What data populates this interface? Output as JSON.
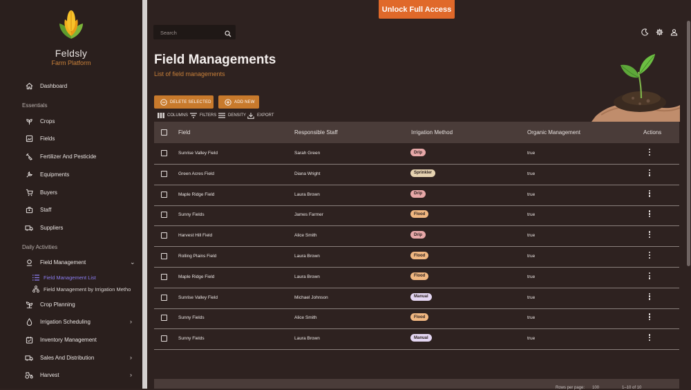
{
  "brand": {
    "name": "Feldsly",
    "subtitle": "Farm Platform"
  },
  "banner": {
    "label": "Unlock Full Access"
  },
  "search": {
    "placeholder": "Search"
  },
  "sidebar": {
    "top": {
      "label": "Dashboard",
      "icon": "home-icon"
    },
    "sections": [
      {
        "title": "Essentials",
        "items": [
          {
            "label": "Crops",
            "icon": "crops-icon"
          },
          {
            "label": "Fields",
            "icon": "fields-icon"
          },
          {
            "label": "Fertilizer And Pesticide",
            "icon": "spray-icon"
          },
          {
            "label": "Equipments",
            "icon": "tools-icon"
          },
          {
            "label": "Buyers",
            "icon": "cart-icon"
          },
          {
            "label": "Staff",
            "icon": "staff-icon"
          },
          {
            "label": "Suppliers",
            "icon": "truck-icon"
          }
        ]
      },
      {
        "title": "Daily Activities",
        "items": [
          {
            "label": "Field Management",
            "icon": "location-icon",
            "expanded": true
          },
          {
            "label": "Crop Planning",
            "icon": "sprout-icon"
          },
          {
            "label": "Irrigation Scheduling",
            "icon": "water-drop-icon"
          },
          {
            "label": "Inventory Management",
            "icon": "inventory-icon"
          },
          {
            "label": "Sales And Distribution",
            "icon": "truck-icon"
          },
          {
            "label": "Harvest",
            "icon": "tractor-icon"
          }
        ]
      }
    ],
    "sub_items": [
      {
        "label": "Field Management List",
        "icon": "list-icon",
        "active": true
      },
      {
        "label": "Field Management by Irrigation Metho",
        "icon": "hierarchy-icon",
        "active": false
      }
    ]
  },
  "page": {
    "title": "Field Managements",
    "subtitle": "List of field managements"
  },
  "actions": {
    "delete_label": "DELETE SELECTED",
    "add_label": "ADD NEW"
  },
  "toolbar": {
    "columns_label": "COLUMNS",
    "filters_label": "FILTERS",
    "density_label": "DENSITY",
    "export_label": "EXPORT"
  },
  "table": {
    "columns": [
      "Field",
      "Responsible Staff",
      "Irrigation Method",
      "Organic Management",
      "Actions"
    ],
    "rows": [
      {
        "field": "Sunrise Valley Field",
        "staff": "Sarah Green",
        "method": "Drip",
        "organic": "true"
      },
      {
        "field": "Green Acres Field",
        "staff": "Diana Wright",
        "method": "Sprinkler",
        "organic": "true"
      },
      {
        "field": "Maple Ridge Field",
        "staff": "Laura Brown",
        "method": "Drip",
        "organic": "true"
      },
      {
        "field": "Sunny Fields",
        "staff": "James Farmer",
        "method": "Flood",
        "organic": "true"
      },
      {
        "field": "Harvest Hill Field",
        "staff": "Alice Smith",
        "method": "Drip",
        "organic": "true"
      },
      {
        "field": "Rolling Plains Field",
        "staff": "Laura Brown",
        "method": "Flood",
        "organic": "true"
      },
      {
        "field": "Maple Ridge Field",
        "staff": "Laura Brown",
        "method": "Flood",
        "organic": "true"
      },
      {
        "field": "Sunrise Valley Field",
        "staff": "Michael Johnson",
        "method": "Manual",
        "organic": "true"
      },
      {
        "field": "Sunny Fields",
        "staff": "Alice Smith",
        "method": "Flood",
        "organic": "true"
      },
      {
        "field": "Sunny Fields",
        "staff": "Laura Brown",
        "method": "Manual",
        "organic": "true"
      }
    ]
  },
  "method_colors": {
    "Drip": "#e7a8a8",
    "Sprinkler": "#e6d3b1",
    "Flood": "#f0b781",
    "Manual": "#e4d6f2"
  },
  "colors": {
    "accent": "#e0692a",
    "button": "#c87a2c",
    "active_nav": "#8a7cf0",
    "background": "#2e2220"
  },
  "footer": {
    "rows_per_page_label": "Rows per page:",
    "rows_per_page": "100",
    "range": "1–10 of 10"
  }
}
